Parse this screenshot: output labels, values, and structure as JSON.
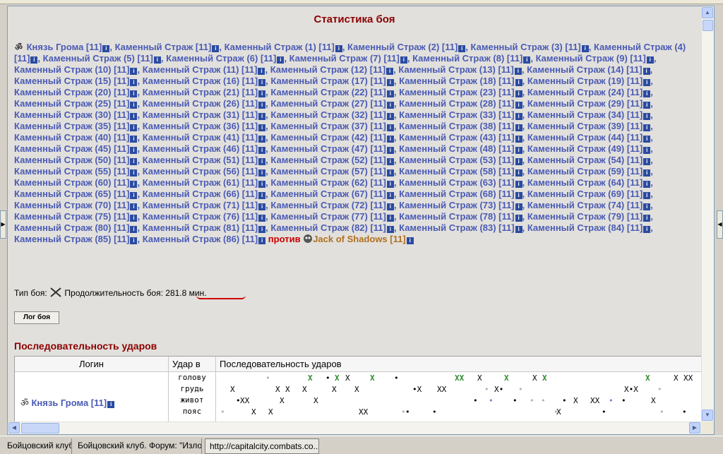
{
  "title": "Статистика боя",
  "fighters": {
    "leader": "Князь Грома [11]",
    "guard_name": "Каменный Страж",
    "guard_level": "[11]",
    "guards_count": 86,
    "versus": "против",
    "enemy": "Jack of Shadows [11]"
  },
  "battle": {
    "type_label": "Тип боя:",
    "duration_label": "Продолжительность боя:",
    "duration_value": "281.8 мин."
  },
  "log_button": "Лог боя",
  "sequence": {
    "title": "Последовательность ударов",
    "headers": [
      "Логин",
      "Удар в",
      "Последовательность ударов"
    ],
    "player": "Князь Грома [11]",
    "zones": [
      "голову",
      "грудь",
      "живот",
      "пояс"
    ]
  },
  "colors": {
    "title": "#8b0000",
    "link": "#4a5bb5",
    "versus": "#cc0000",
    "enemy": "#b07020"
  },
  "taskbar": {
    "items": [
      "Бойцовский клуб",
      "Бойцовский клуб. Форум: \"Изло...",
      "http://capitalcity.combats.co..."
    ]
  }
}
